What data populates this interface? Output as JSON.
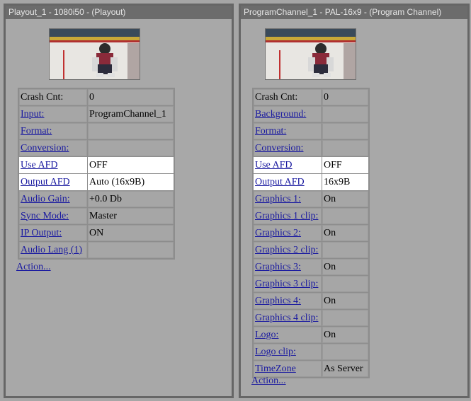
{
  "left": {
    "title": "Playout_1 - 1080i50 - (Playout)",
    "rows": [
      {
        "label": "Crash Cnt:",
        "value": "0",
        "link": false,
        "hl": false
      },
      {
        "label": "Input:",
        "value": "ProgramChannel_1",
        "link": true,
        "hl": false
      },
      {
        "label": "Format:",
        "value": "",
        "link": true,
        "hl": false
      },
      {
        "label": "Conversion:",
        "value": "",
        "link": true,
        "hl": false
      },
      {
        "label": "Use AFD",
        "value": "OFF",
        "link": true,
        "hl": true
      },
      {
        "label": "Output AFD",
        "value": "Auto (16x9B)",
        "link": true,
        "hl": true
      },
      {
        "label": "Audio Gain:",
        "value": "+0.0 Db",
        "link": true,
        "hl": false
      },
      {
        "label": "Sync Mode:",
        "value": "Master",
        "link": true,
        "hl": false
      },
      {
        "label": "IP Output:",
        "value": "ON",
        "link": true,
        "hl": false
      },
      {
        "label": "Audio Lang (1)",
        "value": "",
        "link": true,
        "hl": false
      }
    ],
    "action": "Action..."
  },
  "right": {
    "title": "ProgramChannel_1 - PAL-16x9 - (Program Channel)",
    "rows": [
      {
        "label": "Crash Cnt:",
        "value": "0",
        "link": false,
        "hl": false
      },
      {
        "label": "Background:",
        "value": "",
        "link": true,
        "hl": false
      },
      {
        "label": "Format:",
        "value": "",
        "link": true,
        "hl": false
      },
      {
        "label": "Conversion:",
        "value": "",
        "link": true,
        "hl": false
      },
      {
        "label": "Use AFD",
        "value": "OFF",
        "link": true,
        "hl": true
      },
      {
        "label": "Output AFD",
        "value": "16x9B",
        "link": true,
        "hl": true
      },
      {
        "label": "Graphics 1:",
        "value": "On",
        "link": true,
        "hl": false
      },
      {
        "label": "Graphics 1 clip:",
        "value": "",
        "link": true,
        "hl": false
      },
      {
        "label": "Graphics 2:",
        "value": "On",
        "link": true,
        "hl": false
      },
      {
        "label": "Graphics 2 clip:",
        "value": "",
        "link": true,
        "hl": false
      },
      {
        "label": "Graphics 3:",
        "value": "On",
        "link": true,
        "hl": false
      },
      {
        "label": "Graphics 3 clip:",
        "value": "",
        "link": true,
        "hl": false
      },
      {
        "label": "Graphics 4:",
        "value": "On",
        "link": true,
        "hl": false
      },
      {
        "label": "Graphics 4 clip:",
        "value": "",
        "link": true,
        "hl": false
      },
      {
        "label": "Logo:",
        "value": "On",
        "link": true,
        "hl": false
      },
      {
        "label": "Logo clip:",
        "value": "",
        "link": true,
        "hl": false
      },
      {
        "label": "TimeZone",
        "value": "As Server",
        "link": true,
        "hl": false
      }
    ],
    "action": "Action..."
  },
  "thumbnail": {
    "icon": "hockey-goalie-video-frame"
  }
}
